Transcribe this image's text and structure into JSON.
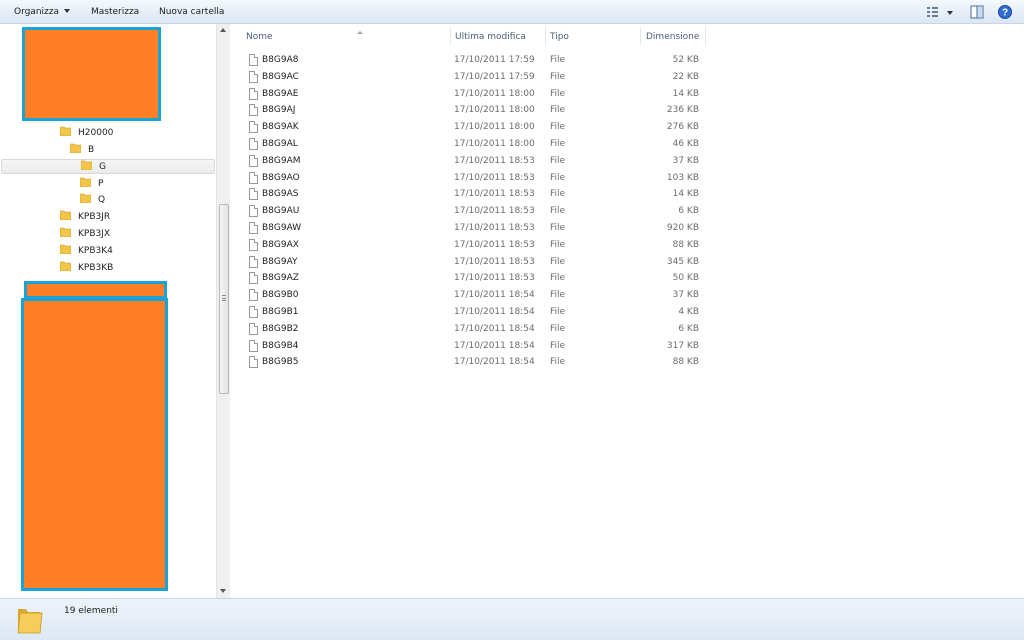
{
  "toolbar": {
    "organize_label": "Organizza",
    "burn_label": "Masterizza",
    "new_folder_label": "Nuova cartella",
    "icons": [
      "view-options-icon",
      "preview-pane-icon",
      "help-icon"
    ]
  },
  "nav": {
    "tree": [
      {
        "label": "H20000",
        "level": 0
      },
      {
        "label": "B",
        "level": 1
      },
      {
        "label": "G",
        "level": 2,
        "selected": true
      },
      {
        "label": "P",
        "level": 2
      },
      {
        "label": "Q",
        "level": 2
      },
      {
        "label": "KPB3JR",
        "level": 0
      },
      {
        "label": "KPB3JX",
        "level": 0
      },
      {
        "label": "KPB3K4",
        "level": 0
      },
      {
        "label": "KPB3KB",
        "level": 0
      }
    ],
    "redaction_color": "#ff7f27",
    "redaction_border": "#1aa3d6"
  },
  "list": {
    "columns": {
      "name": "Nome",
      "modified": "Ultima modifica",
      "type": "Tipo",
      "size": "Dimensione"
    },
    "rows": [
      {
        "name": "B8G9A8",
        "modified": "17/10/2011 17:59",
        "type": "File",
        "size": "52 KB"
      },
      {
        "name": "B8G9AC",
        "modified": "17/10/2011 17:59",
        "type": "File",
        "size": "22 KB"
      },
      {
        "name": "B8G9AE",
        "modified": "17/10/2011 18:00",
        "type": "File",
        "size": "14 KB"
      },
      {
        "name": "B8G9AJ",
        "modified": "17/10/2011 18:00",
        "type": "File",
        "size": "236 KB"
      },
      {
        "name": "B8G9AK",
        "modified": "17/10/2011 18:00",
        "type": "File",
        "size": "276 KB"
      },
      {
        "name": "B8G9AL",
        "modified": "17/10/2011 18:00",
        "type": "File",
        "size": "46 KB"
      },
      {
        "name": "B8G9AM",
        "modified": "17/10/2011 18:53",
        "type": "File",
        "size": "37 KB"
      },
      {
        "name": "B8G9AO",
        "modified": "17/10/2011 18:53",
        "type": "File",
        "size": "103 KB"
      },
      {
        "name": "B8G9AS",
        "modified": "17/10/2011 18:53",
        "type": "File",
        "size": "14 KB"
      },
      {
        "name": "B8G9AU",
        "modified": "17/10/2011 18:53",
        "type": "File",
        "size": "6 KB"
      },
      {
        "name": "B8G9AW",
        "modified": "17/10/2011 18:53",
        "type": "File",
        "size": "920 KB"
      },
      {
        "name": "B8G9AX",
        "modified": "17/10/2011 18:53",
        "type": "File",
        "size": "88 KB"
      },
      {
        "name": "B8G9AY",
        "modified": "17/10/2011 18:53",
        "type": "File",
        "size": "345 KB"
      },
      {
        "name": "B8G9AZ",
        "modified": "17/10/2011 18:53",
        "type": "File",
        "size": "50 KB"
      },
      {
        "name": "B8G9B0",
        "modified": "17/10/2011 18:54",
        "type": "File",
        "size": "37 KB"
      },
      {
        "name": "B8G9B1",
        "modified": "17/10/2011 18:54",
        "type": "File",
        "size": "4 KB"
      },
      {
        "name": "B8G9B2",
        "modified": "17/10/2011 18:54",
        "type": "File",
        "size": "6 KB"
      },
      {
        "name": "B8G9B4",
        "modified": "17/10/2011 18:54",
        "type": "File",
        "size": "317 KB"
      },
      {
        "name": "B8G9B5",
        "modified": "17/10/2011 18:54",
        "type": "File",
        "size": "88 KB"
      }
    ]
  },
  "status": {
    "count_text": "19 elementi"
  }
}
